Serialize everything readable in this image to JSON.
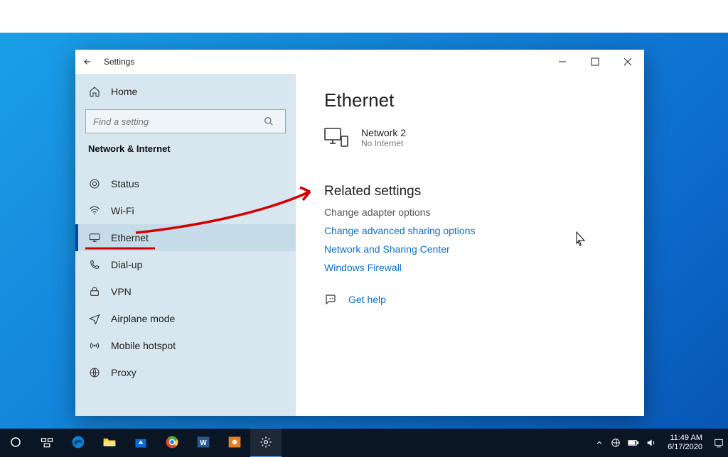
{
  "window": {
    "title": "Settings",
    "min": "—",
    "max": "☐",
    "close": "✕"
  },
  "sidebar": {
    "home_label": "Home",
    "search_placeholder": "Find a setting",
    "category": "Network & Internet",
    "items": [
      {
        "label": "Status"
      },
      {
        "label": "Wi-Fi"
      },
      {
        "label": "Ethernet"
      },
      {
        "label": "Dial-up"
      },
      {
        "label": "VPN"
      },
      {
        "label": "Airplane mode"
      },
      {
        "label": "Mobile hotspot"
      },
      {
        "label": "Proxy"
      }
    ]
  },
  "content": {
    "heading": "Ethernet",
    "network_name": "Network 2",
    "network_status": "No Internet",
    "related_heading": "Related settings",
    "links": [
      "Change adapter options",
      "Change advanced sharing options",
      "Network and Sharing Center",
      "Windows Firewall"
    ],
    "help_label": "Get help"
  },
  "taskbar": {
    "time": "11:49 AM",
    "date": "6/17/2020"
  }
}
